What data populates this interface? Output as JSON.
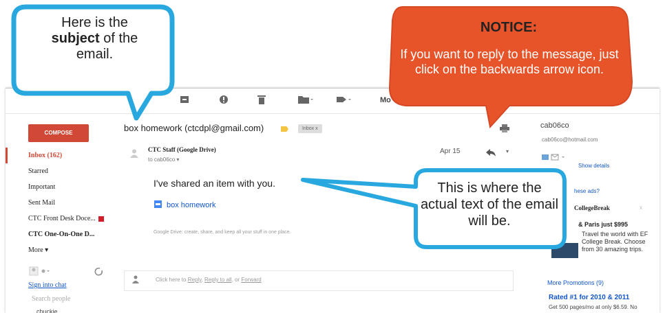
{
  "gmail": {
    "compose_label": "COMPOSE",
    "nav": [
      {
        "label": "Inbox (162)",
        "active": true
      },
      {
        "label": "Starred"
      },
      {
        "label": "Important"
      },
      {
        "label": "Sent Mail"
      },
      {
        "label": "CTC Front Desk Doce..."
      },
      {
        "label": "CTC One-On-One D..."
      },
      {
        "label": "More ▾"
      }
    ],
    "sign_in_chat": "Sign into chat",
    "search_people_placeholder": "Search people",
    "contact_partial": "chuckie",
    "toolbar": {
      "icons": [
        "archive-icon",
        "spam-icon",
        "delete-icon",
        "move-to-icon",
        "labels-icon"
      ],
      "more_label": "Mo"
    },
    "subject": "box homework (ctcdpl@gmail.com)",
    "inbox_chip": "Inbox  x",
    "sender": "CTC Staff (Google Drive)",
    "to_line": "to cab06co  ▾",
    "date": "Apr 15",
    "body_text": "I've shared an item with you.",
    "drive_link": "box homework",
    "drive_footer": "Google Drive: create, share, and keep all your stuff in one place.",
    "reply_hint": {
      "prefix": "Click here to ",
      "reply": "Reply",
      "sep1": ", ",
      "reply_all": "Reply to all",
      "sep2": ", or ",
      "forward": "Forward"
    },
    "right": {
      "name": "cab06co",
      "email": "cab06co@hotmail.com",
      "show_details": "Show details",
      "ads_question": "hese ads?",
      "ad_title": "CollegeBreak",
      "ad_close": "x",
      "ad_head": "& Paris just $995",
      "ad_body": "Travel the world with EF College Break. Choose from 30 amazing trips.",
      "more_promotions": "More Promotions (9)",
      "rated": "Rated #1 for 2010 & 2011",
      "get": "Get 500 pages/mo at only $6.59. No"
    }
  },
  "callouts": {
    "subject_line1": "Here is the",
    "subject_bold": "subject",
    "subject_rest": " of the",
    "subject_line3": "email.",
    "notice_title": "NOTICE:",
    "notice_body": "If you want to reply to the message, just click on the backwards arrow icon.",
    "text_callout": "This is where the actual text of the email will be."
  },
  "colors": {
    "compose_red": "#d14836",
    "callout_blue": "#29a8e0",
    "notice_orange": "#e8542a",
    "link_blue": "#1155cc"
  }
}
